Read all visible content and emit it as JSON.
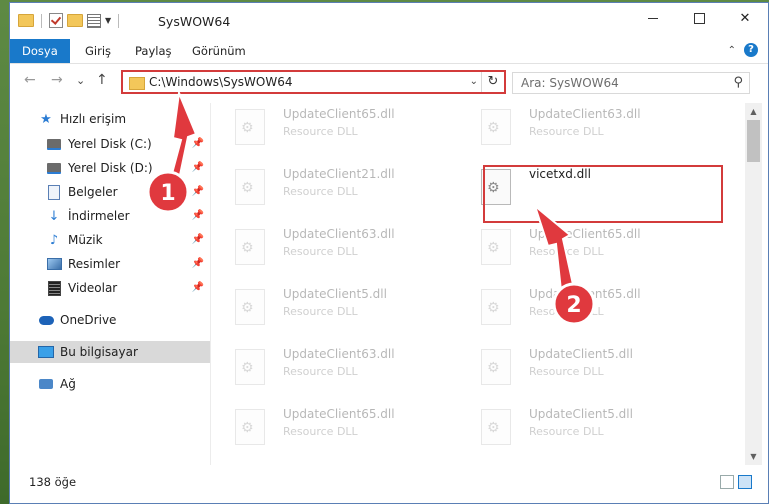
{
  "window": {
    "title": "SysWOW64",
    "controls": {
      "minimize": "—",
      "maximize": "☐",
      "close": "✕"
    }
  },
  "ribbon": {
    "tabs": [
      {
        "label": "Dosya",
        "active": true
      },
      {
        "label": "Giriş"
      },
      {
        "label": "Paylaş"
      },
      {
        "label": "Görünüm"
      }
    ],
    "collapse": "⌃",
    "help": "?"
  },
  "nav": {
    "back": "←",
    "forward": "→",
    "recent": "⌄",
    "up": "↑",
    "address": "C:\\Windows\\SysWOW64",
    "address_dropdown": "⌄",
    "refresh": "↻",
    "search_placeholder": "Ara: SysWOW64",
    "search_icon": "⚲"
  },
  "sidebar": {
    "items": [
      {
        "label": "Hızlı erişim",
        "icon": "star-icon",
        "glyph": "★",
        "pinned": false
      },
      {
        "label": "Yerel Disk (C:)",
        "icon": "disk-icon",
        "pinned": true
      },
      {
        "label": "Yerel Disk (D:)",
        "icon": "disk-icon",
        "pinned": true
      },
      {
        "label": "Belgeler",
        "icon": "document-icon",
        "pinned": true
      },
      {
        "label": "İndirmeler",
        "icon": "download-icon",
        "glyph": "↓",
        "pinned": true
      },
      {
        "label": "Müzik",
        "icon": "music-icon",
        "glyph": "♪",
        "pinned": true
      },
      {
        "label": "Resimler",
        "icon": "pictures-icon",
        "pinned": true
      },
      {
        "label": "Videolar",
        "icon": "videos-icon",
        "pinned": true
      },
      {
        "label": "OneDrive",
        "icon": "cloud-icon"
      },
      {
        "label": "Bu bilgisayar",
        "icon": "computer-icon",
        "selected": true
      },
      {
        "label": "Ağ",
        "icon": "network-icon"
      }
    ],
    "pin_glyph": "📌"
  },
  "files": [
    {
      "name": "UpdateClient65.dll",
      "type": "Resource DLL",
      "faded": true
    },
    {
      "name": "UpdateClient63.dll",
      "type": "Resource DLL",
      "faded": true
    },
    {
      "name": "UpdateClient21.dll",
      "type": "Resource DLL",
      "faded": true
    },
    {
      "name": "vicetxd.dll",
      "type": "",
      "faded": false,
      "highlighted": true
    },
    {
      "name": "UpdateClient63.dll",
      "type": "Resource DLL",
      "faded": true
    },
    {
      "name": "UpdateClient65.dll",
      "type": "Resource DLL",
      "faded": true
    },
    {
      "name": "UpdateClient5.dll",
      "type": "Resource DLL",
      "faded": true
    },
    {
      "name": "UpdateClient65.dll",
      "type": "Resource DLL",
      "faded": true
    },
    {
      "name": "UpdateClient63.dll",
      "type": "Resource DLL",
      "faded": true
    },
    {
      "name": "UpdateClient5.dll",
      "type": "Resource DLL",
      "faded": true
    },
    {
      "name": "UpdateClient65.dll",
      "type": "Resource DLL",
      "faded": true
    },
    {
      "name": "UpdateClient5.dll",
      "type": "Resource DLL",
      "faded": true
    }
  ],
  "status": {
    "count_text": "138 öğe"
  },
  "annotations": [
    {
      "number": "1",
      "color": "#e0393e"
    },
    {
      "number": "2",
      "color": "#e0393e"
    }
  ],
  "colors": {
    "accent": "#1979ca",
    "highlight": "#d33b3b"
  }
}
